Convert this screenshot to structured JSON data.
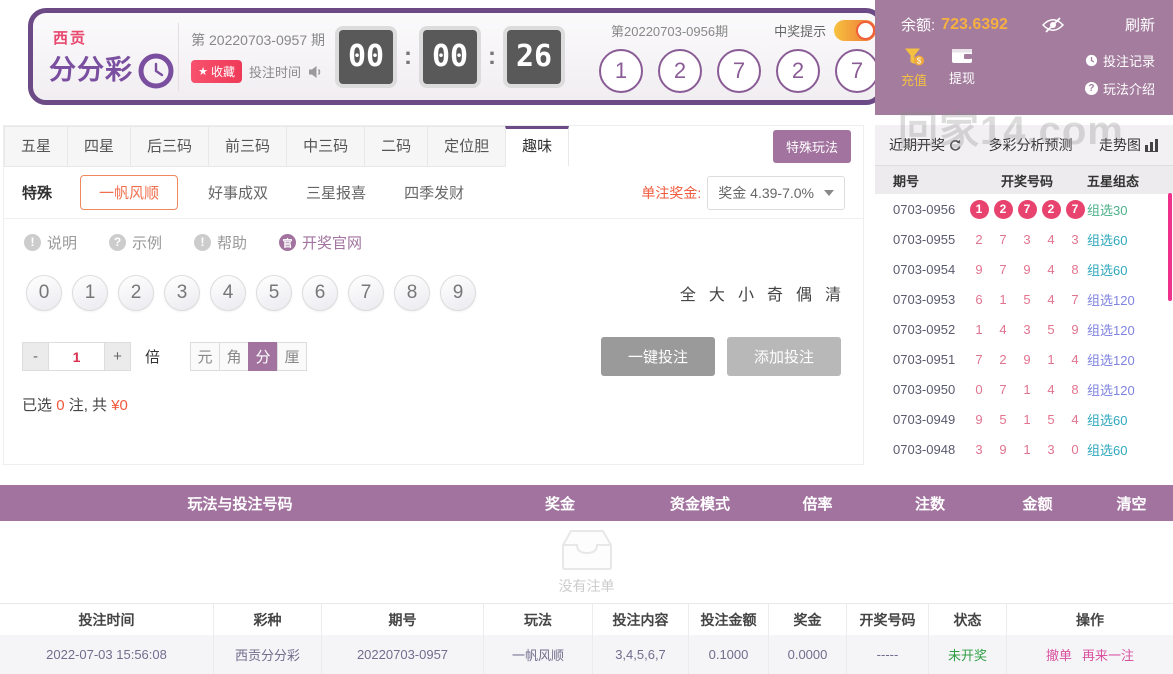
{
  "header": {
    "logo_line1": "西贡",
    "logo_line2": "分分彩",
    "current_period": "第 20220703-0957 期",
    "favorite_label": "收藏",
    "favorite_star": "★",
    "bet_time_label": "投注时间",
    "countdown": {
      "hours": "00",
      "minutes": "00",
      "seconds": "26"
    },
    "last_period": "第20220703-0956期",
    "win_tip_label": "中奖提示",
    "winning_numbers": [
      "1",
      "2",
      "7",
      "2",
      "7"
    ]
  },
  "account": {
    "balance_label": "余额:",
    "balance": "723.6392",
    "refresh_label": "刷新",
    "recharge_label": "充值",
    "withdraw_label": "提现",
    "bet_record_label": "投注记录",
    "play_intro_label": "玩法介绍"
  },
  "watermark": "回家14.com",
  "tabs": [
    "五星",
    "四星",
    "后三码",
    "前三码",
    "中三码",
    "二码",
    "定位胆",
    "趣味"
  ],
  "active_tab": "趣味",
  "special_play_button": "特殊玩法",
  "play_row": {
    "group_label": "特殊",
    "options": [
      "一帆风顺",
      "好事成双",
      "三星报喜",
      "四季发财"
    ],
    "selected_option": "一帆风顺",
    "prize_label": "单注奖金:",
    "prize_value": "奖金 4.39-7.0%"
  },
  "help_row": {
    "explain": "说明",
    "example": "示例",
    "help": "帮助",
    "official": "开奖官网",
    "official_icon_char": "官",
    "bang": "!",
    "question": "?"
  },
  "balls": [
    "0",
    "1",
    "2",
    "3",
    "4",
    "5",
    "6",
    "7",
    "8",
    "9"
  ],
  "quick_select": [
    "全",
    "大",
    "小",
    "奇",
    "偶",
    "清"
  ],
  "bet_controls": {
    "minus": "-",
    "multiplier": "1",
    "plus": "+",
    "times_label": "倍",
    "units": [
      "元",
      "角",
      "分",
      "厘"
    ],
    "active_unit": "分",
    "one_key_bet": "一键投注",
    "add_bet": "添加投注"
  },
  "selection_summary": {
    "prefix": "已选",
    "count": "0",
    "mid": "注, 共",
    "amount": "¥0"
  },
  "recent": {
    "tabs": [
      "近期开奖",
      "多彩分析预测",
      "走势图"
    ],
    "headers": [
      "期号",
      "开奖号码",
      "五星组态"
    ],
    "rows": [
      {
        "period": "0703-0956",
        "digits": [
          "1",
          "2",
          "7",
          "2",
          "7"
        ],
        "type": "组选30"
      },
      {
        "period": "0703-0955",
        "digits": [
          "2",
          "7",
          "3",
          "4",
          "3"
        ],
        "type": "组选60"
      },
      {
        "period": "0703-0954",
        "digits": [
          "9",
          "7",
          "9",
          "4",
          "8"
        ],
        "type": "组选60"
      },
      {
        "period": "0703-0953",
        "digits": [
          "6",
          "1",
          "5",
          "4",
          "7"
        ],
        "type": "组选120"
      },
      {
        "period": "0703-0952",
        "digits": [
          "1",
          "4",
          "3",
          "5",
          "9"
        ],
        "type": "组选120"
      },
      {
        "period": "0703-0951",
        "digits": [
          "7",
          "2",
          "9",
          "1",
          "4"
        ],
        "type": "组选120"
      },
      {
        "period": "0703-0950",
        "digits": [
          "0",
          "7",
          "1",
          "4",
          "8"
        ],
        "type": "组选120"
      },
      {
        "period": "0703-0949",
        "digits": [
          "9",
          "5",
          "1",
          "5",
          "4"
        ],
        "type": "组选60"
      },
      {
        "period": "0703-0948",
        "digits": [
          "3",
          "9",
          "1",
          "3",
          "0"
        ],
        "type": "组选60"
      }
    ]
  },
  "cart": {
    "headers": [
      "玩法与投注号码",
      "奖金",
      "资金模式",
      "倍率",
      "注数",
      "金额",
      "清空"
    ],
    "empty_text": "没有注单"
  },
  "orders": {
    "headers": [
      "投注时间",
      "彩种",
      "期号",
      "玩法",
      "投注内容",
      "投注金额",
      "奖金",
      "开奖号码",
      "状态",
      "操作"
    ],
    "row": {
      "time": "2022-07-03 15:56:08",
      "lottery": "西贡分分彩",
      "period": "20220703-0957",
      "play": "一帆风顺",
      "content": "3,4,5,6,7",
      "amount": "0.1000",
      "prize": "0.0000",
      "numbers": "-----",
      "status": "未开奖",
      "action_cancel": "撤单",
      "action_again": "再来一注"
    }
  },
  "colors": {
    "accent_purple": "#a2739f",
    "border_purple": "#6b4a86",
    "logo_purple": "#7b4fa0",
    "logo_pink": "#e8486e",
    "orange": "#f05a3c",
    "balance_orange": "#f5b041",
    "hot_ball_pink": "#e8436e",
    "type_30": "#4cb08a",
    "type_60": "#2fa8bd",
    "type_120": "#7f83e0",
    "status_green": "#2f9e44",
    "action_pink": "#d9519f"
  }
}
